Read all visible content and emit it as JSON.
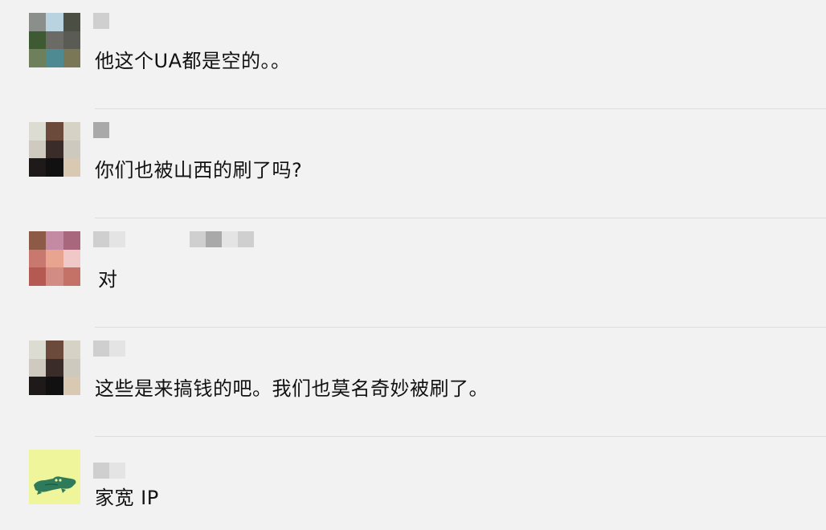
{
  "messages": [
    {
      "text": "他这个UA都是空的。。"
    },
    {
      "text": "你们也被山西的刷了吗?"
    },
    {
      "text": "对"
    },
    {
      "text": "这些是来搞钱的吧。我们也莫名奇妙被刷了。"
    },
    {
      "text": "家宽 IP"
    }
  ]
}
